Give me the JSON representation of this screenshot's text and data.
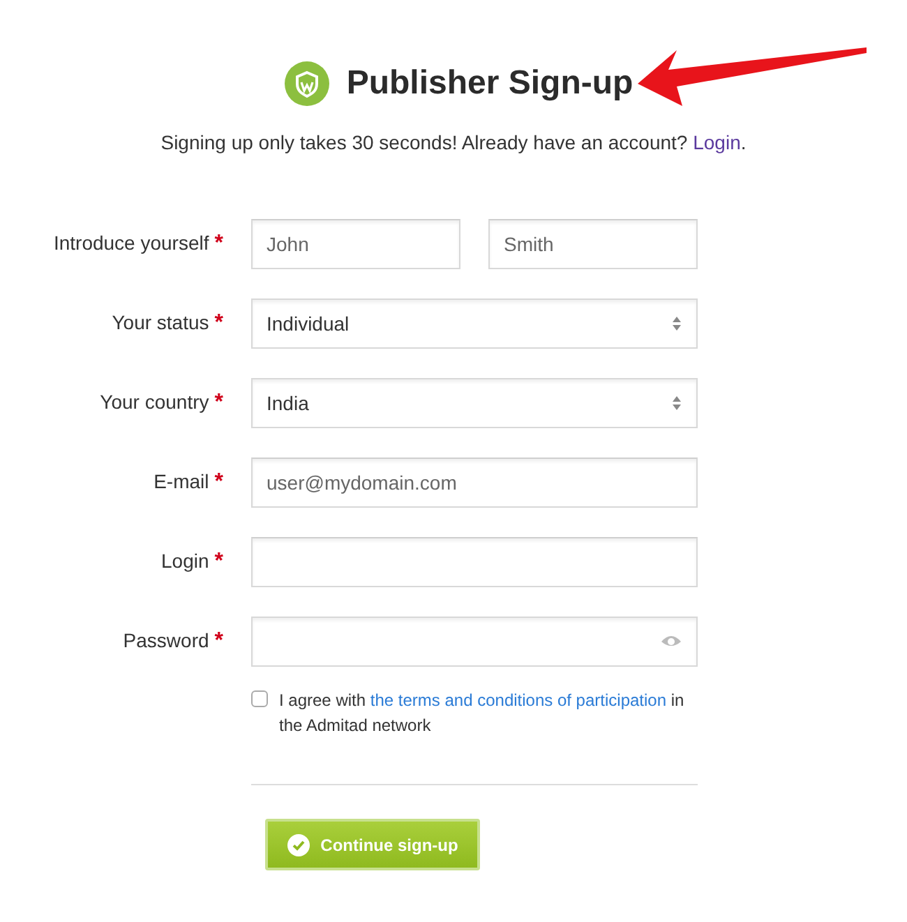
{
  "header": {
    "title": "Publisher Sign-up",
    "subtitle": {
      "before": "Signing up only takes 30 seconds! Already have an account?",
      "link": "Login",
      "after": "."
    }
  },
  "fields": [
    {
      "kind": "name-pair",
      "label": "Introduce yourself",
      "required_mark": "*",
      "inputs": [
        {
          "placeholder": "John"
        },
        {
          "placeholder": "Smith"
        }
      ]
    },
    {
      "kind": "select",
      "label": "Your status",
      "required_mark": "*",
      "value": "Individual"
    },
    {
      "kind": "select",
      "label": "Your country",
      "required_mark": "*",
      "value": "India"
    },
    {
      "kind": "text",
      "label": "E-mail",
      "required_mark": "*",
      "placeholder": "user@mydomain.com"
    },
    {
      "kind": "text",
      "label": "Login",
      "required_mark": "*"
    },
    {
      "kind": "password",
      "label": "Password",
      "required_mark": "*"
    }
  ],
  "agreement": {
    "checked": false,
    "before": "I agree with",
    "link": "the terms and conditions of participation",
    "after": "in the Admitad network"
  },
  "submit": {
    "label": "Continue sign-up"
  }
}
